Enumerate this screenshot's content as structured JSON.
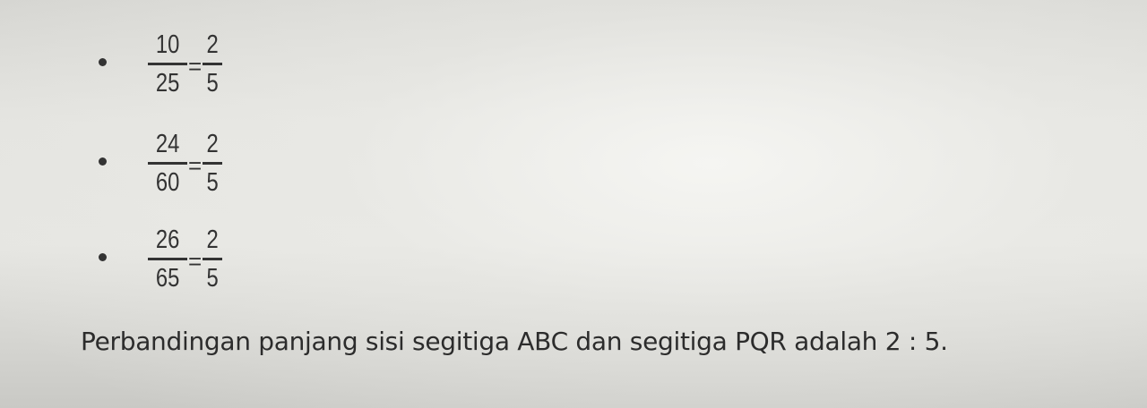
{
  "fractions": [
    {
      "lhs_num": "10",
      "lhs_den": "25",
      "eq": "=",
      "rhs_num": "2",
      "rhs_den": "5"
    },
    {
      "lhs_num": "24",
      "lhs_den": "60",
      "eq": "=",
      "rhs_num": "2",
      "rhs_den": "5"
    },
    {
      "lhs_num": "26",
      "lhs_den": "65",
      "eq": "=",
      "rhs_num": "2",
      "rhs_den": "5"
    }
  ],
  "conclusion": "Perbandingan panjang sisi segitiga ABC dan segitiga PQR adalah 2 : 5."
}
